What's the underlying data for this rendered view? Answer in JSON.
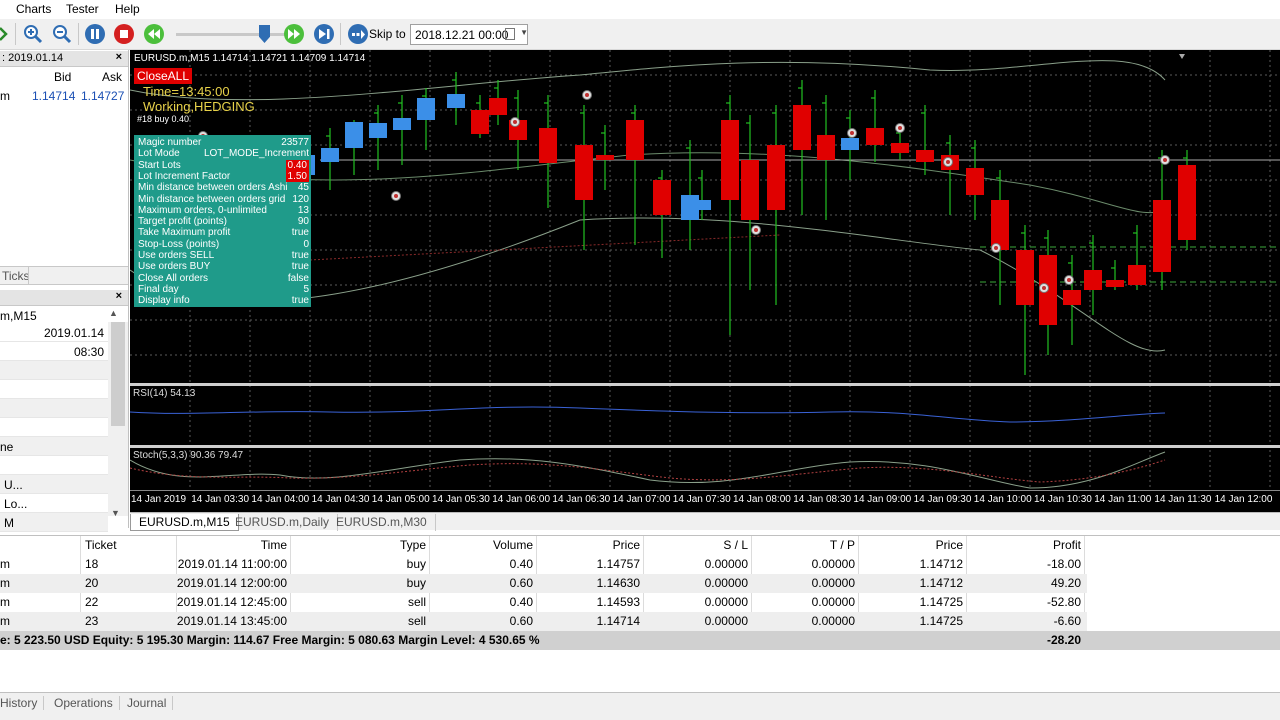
{
  "menu": {
    "items": [
      "Charts",
      "Tester",
      "Help"
    ]
  },
  "toolbar": {
    "skip_label": "Skip to",
    "skip_date": "2018.12.21 00:00",
    "icons": [
      "zoom-in-icon",
      "zoom-out-icon",
      "pause-icon",
      "stop-icon",
      "rewind-icon",
      "forward-icon",
      "skip-end-icon",
      "skip-to-icon"
    ]
  },
  "market_watch": {
    "title": ": 2019.01.14",
    "col_bid": "Bid",
    "col_ask": "Ask",
    "row_symbol": "m",
    "row_bid": "1.14714",
    "row_ask": "1.14727",
    "ticks_tab": "Ticks"
  },
  "data_window": {
    "symbol": "m,M15",
    "rows": [
      "",
      "",
      "",
      "",
      "",
      "ne",
      "",
      "U...",
      "Lo...",
      "M"
    ],
    "date": "2019.01.14",
    "time": "08:30"
  },
  "chart": {
    "title": "EURUSD.m,M15  1.14714 1.14721 1.14709 1.14714",
    "close_all": "CloseALL",
    "time": "Time=13:45:00",
    "status": "Working,HEDGING",
    "order_label": "#18 buy 0.40",
    "rsi_label": "RSI(14) 54.13",
    "stoch_label": "Stoch(5,3,3) 90.36 79.47",
    "x_labels": [
      "14 Jan 2019",
      "14 Jan 03:30",
      "14 Jan 04:00",
      "14 Jan 04:30",
      "14 Jan 05:00",
      "14 Jan 05:30",
      "14 Jan 06:00",
      "14 Jan 06:30",
      "14 Jan 07:00",
      "14 Jan 07:30",
      "14 Jan 08:00",
      "14 Jan 08:30",
      "14 Jan 09:00",
      "14 Jan 09:30",
      "14 Jan 10:00",
      "14 Jan 10:30",
      "14 Jan 11:00",
      "14 Jan 11:30",
      "14 Jan 12:00"
    ],
    "colors": {
      "bull": "#3b8fe8",
      "bear": "#e00000",
      "wick": "#22c022",
      "panel": "#1f9b8a"
    }
  },
  "info_panel": {
    "rows": [
      {
        "label": "Magic number",
        "value": "23577",
        "red": false
      },
      {
        "label": "Lot Mode",
        "value": "LOT_MODE_Increment",
        "red": false
      },
      {
        "label": "Start Lots",
        "value": "0.40",
        "red": true
      },
      {
        "label": "Lot Increment Factor",
        "value": "1.50",
        "red": true
      },
      {
        "label": "Min distance between orders Ashi",
        "value": "45",
        "red": false
      },
      {
        "label": "Min distance between orders grid",
        "value": "120",
        "red": false
      },
      {
        "label": "Maximum orders, 0-unlimited",
        "value": "13",
        "red": false
      },
      {
        "label": "Target profit (points)",
        "value": "90",
        "red": false
      },
      {
        "label": "Take Maximum profit",
        "value": "true",
        "red": false
      },
      {
        "label": "Stop-Loss (points)",
        "value": "0",
        "red": false
      },
      {
        "label": "Use orders SELL",
        "value": "true",
        "red": false
      },
      {
        "label": "Use orders BUY",
        "value": "true",
        "red": false
      },
      {
        "label": "Close All orders",
        "value": "false",
        "red": false
      },
      {
        "label": "Final day",
        "value": "5",
        "red": false
      },
      {
        "label": "Display info",
        "value": "true",
        "red": false
      }
    ]
  },
  "chart_tabs": [
    "EURUSD.m,M15",
    "EURUSD.m,Daily",
    "EURUSD.m,M30"
  ],
  "trades": {
    "headers": {
      "ticket": "Ticket",
      "time": "Time",
      "type": "Type",
      "volume": "Volume",
      "price": "Price",
      "sl": "S / L",
      "tp": "T / P",
      "price2": "Price",
      "profit": "Profit"
    },
    "rows": [
      {
        "sym": "m",
        "ticket": "18",
        "time": "2019.01.14 11:00:00",
        "type": "buy",
        "volume": "0.40",
        "price": "1.14757",
        "sl": "0.00000",
        "tp": "0.00000",
        "price2": "1.14712",
        "profit": "-18.00"
      },
      {
        "sym": "m",
        "ticket": "20",
        "time": "2019.01.14 12:00:00",
        "type": "buy",
        "volume": "0.60",
        "price": "1.14630",
        "sl": "0.00000",
        "tp": "0.00000",
        "price2": "1.14712",
        "profit": "49.20"
      },
      {
        "sym": "m",
        "ticket": "22",
        "time": "2019.01.14 12:45:00",
        "type": "sell",
        "volume": "0.40",
        "price": "1.14593",
        "sl": "0.00000",
        "tp": "0.00000",
        "price2": "1.14725",
        "profit": "-52.80"
      },
      {
        "sym": "m",
        "ticket": "23",
        "time": "2019.01.14 13:45:00",
        "type": "sell",
        "volume": "0.60",
        "price": "1.14714",
        "sl": "0.00000",
        "tp": "0.00000",
        "price2": "1.14725",
        "profit": "-6.60"
      }
    ],
    "summary": "e: 5 223.50 USD  Equity: 5 195.30  Margin: 114.67  Free Margin: 5 080.63  Margin Level: 4 530.65 %",
    "summary_profit": "-28.20"
  },
  "bottom_tabs": [
    "History",
    "Operations",
    "Journal"
  ]
}
